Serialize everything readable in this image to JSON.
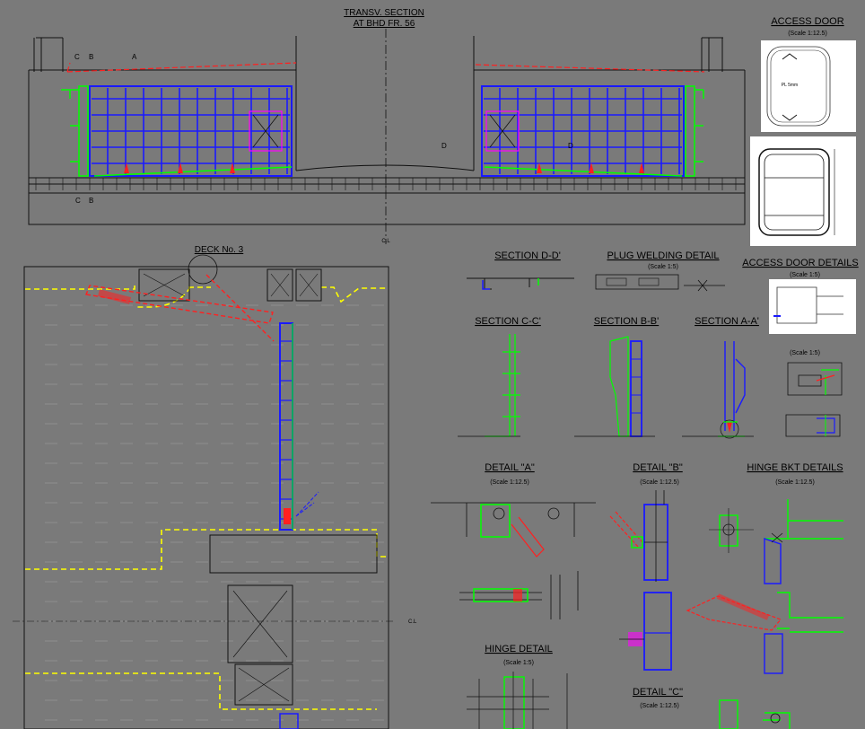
{
  "titles": {
    "transverse_section": [
      "TRANSV. SECTION",
      "AT BHD FR. 56"
    ],
    "access_door": "ACCESS DOOR",
    "access_door_scale": "(Scale 1:12.5)",
    "deck_no_3": "DECK No. 3",
    "section_d": "SECTION D-D'",
    "plug_welding": "PLUG WELDING DETAIL",
    "plug_welding_scale": "(Scale 1:5)",
    "access_door_details": "ACCESS DOOR DETAILS",
    "access_door_details_scale": "(Scale 1:5)",
    "section_c": "SECTION C-C'",
    "section_b": "SECTION B-B'",
    "section_a": "SECTION A-A'",
    "small_scale": "(Scale 1:5)",
    "detail_a": "DETAIL \"A\"",
    "detail_a_scale": "(Scale 1:12.5)",
    "detail_b": "DETAIL \"B\"",
    "detail_b_scale": "(Scale 1:12.5)",
    "hinge_bkt": "HINGE BKT DETAILS",
    "hinge_bkt_scale": "(Scale 1:12.5)",
    "hinge_detail": "HINGE DETAIL",
    "hinge_detail_scale": "(Scale 1:5)",
    "detail_c": "DETAIL \"C\"",
    "detail_c_scale": "(Scale 1:12.5)"
  },
  "markers": {
    "a": "A",
    "b": "B",
    "c": "C",
    "d": "D",
    "centerline": "C.L",
    "pl": "PL 5mm"
  },
  "colors": {
    "background": "#7a7a7a",
    "linework": "#1a1a1a",
    "panel_blue": "#1a1aff",
    "stiffener_green": "#00ff00",
    "hatch_red": "#ff2020",
    "deck_edge_yellow": "#ffff00",
    "magenta": "#ff00ff"
  }
}
